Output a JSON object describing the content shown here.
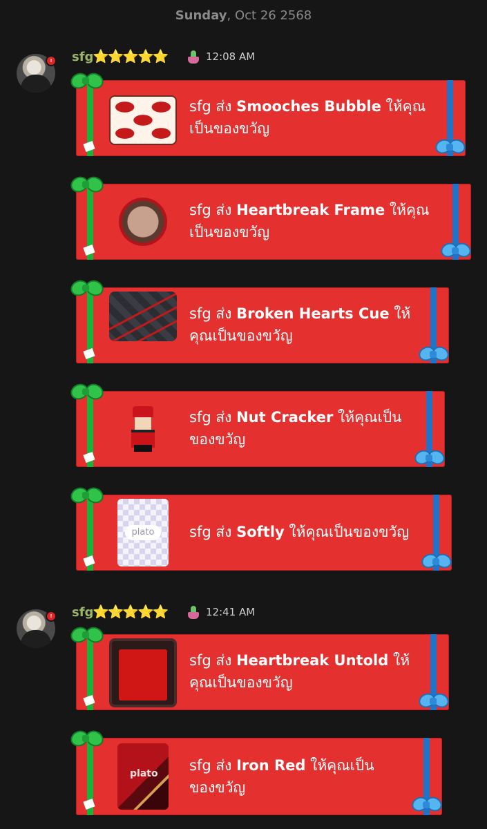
{
  "date": {
    "day": "Sunday",
    "rest": ", Oct 26 2568"
  },
  "groups": [
    {
      "sender": "sfg",
      "stars": "⭐⭐⭐⭐⭐",
      "time": "12:08 AM",
      "notif": "!"
    },
    {
      "sender": "sfg",
      "stars": "⭐⭐⭐⭐⭐",
      "time": "12:41 AM",
      "notif": "!"
    }
  ],
  "gifts": [
    {
      "pre": "sfg ส่ง ",
      "item": "Smooches Bubble",
      "post1": " ให้คุณ",
      "line2": "เป็นของขวัญ",
      "thumb": "lips-icon"
    },
    {
      "pre": "sfg ส่ง ",
      "item": "Heartbreak Frame",
      "post1": " ให้คุณ",
      "line2": "เป็นของขวัญ",
      "thumb": "frame-icon"
    },
    {
      "pre": "sfg ส่ง ",
      "item": "Broken Hearts Cue",
      "post1": " ให้",
      "line2": "คุณเป็นของขวัญ",
      "thumb": "cue-icon"
    },
    {
      "pre": "sfg ส่ง ",
      "item": "Nut Cracker",
      "post1": " ให้คุณเป็น",
      "line2": "ของขวัญ",
      "thumb": "nutcracker-icon"
    },
    {
      "pre": "sfg ส่ง ",
      "item": "Softly",
      "post1": " ให้คุณเป็นของขวัญ",
      "line2": "",
      "thumb": "plato-card-icon",
      "logo": "plato"
    },
    {
      "pre": "sfg ส่ง ",
      "item": "Heartbreak Untold",
      "post1": " ให้",
      "line2": "คุณเป็นของขวัญ",
      "thumb": "table-icon"
    },
    {
      "pre": "sfg ส่ง ",
      "item": "Iron Red",
      "post1": " ให้คุณเป็น",
      "line2": "ของขวัญ",
      "thumb": "plato-card-icon",
      "logo": "plato"
    }
  ],
  "colors": {
    "card": "#e53030",
    "green_ribbon": "#1bb43a",
    "blue_ribbon": "#1f74c9",
    "name": "#9bb36b"
  }
}
